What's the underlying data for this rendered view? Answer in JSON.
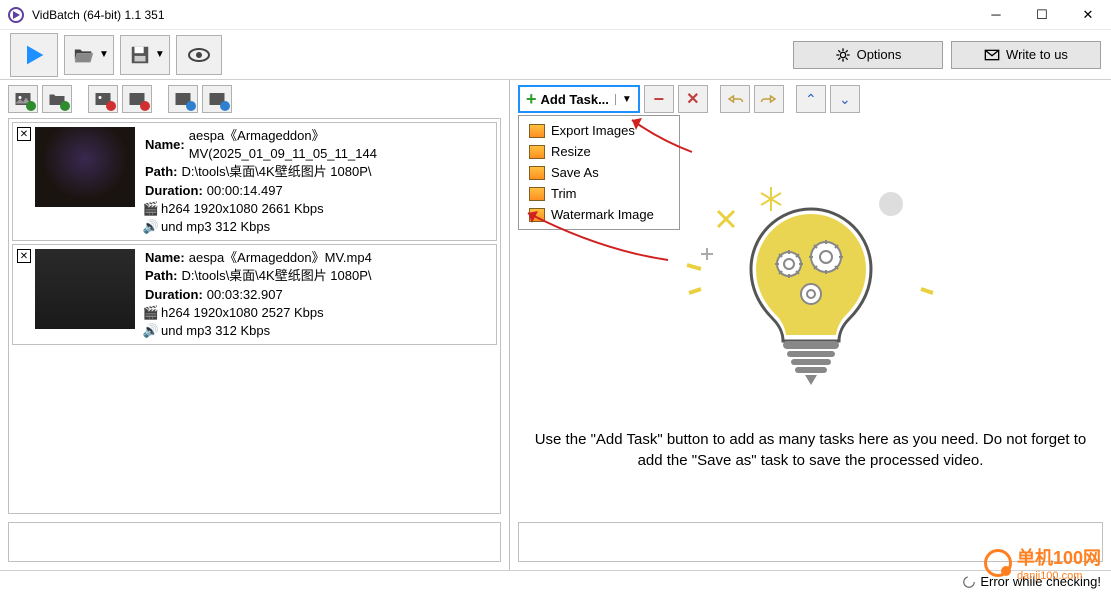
{
  "title": "VidBatch (64-bit) 1.1 351",
  "toolbar": {
    "options_label": "Options",
    "write_label": "Write to us"
  },
  "add_task": {
    "label": "Add Task...",
    "menu": [
      "Export Images",
      "Resize",
      "Save As",
      "Trim",
      "Watermark Image"
    ]
  },
  "files": [
    {
      "name": "aespa《Armageddon》MV(2025_01_09_11_05_11_144",
      "path": "D:\\tools\\桌面\\4K壁纸图片 1080P\\",
      "duration": "00:00:14.497",
      "video": "h264 1920x1080 2661 Kbps",
      "audio": "und mp3 312 Kbps"
    },
    {
      "name": "aespa《Armageddon》MV.mp4",
      "path": "D:\\tools\\桌面\\4K壁纸图片 1080P\\",
      "duration": "00:03:32.907",
      "video": "h264 1920x1080 2527 Kbps",
      "audio": "und mp3 312 Kbps"
    }
  ],
  "labels": {
    "name": "Name:",
    "path": "Path:",
    "duration": "Duration:"
  },
  "hint_text": "Use the \"Add Task\" button to add as many tasks here as you need. Do not forget to add the \"Save as\" task to save the processed video.",
  "status": "Error while checking!",
  "watermark": {
    "text": "单机100网",
    "url": "danji100.com"
  }
}
